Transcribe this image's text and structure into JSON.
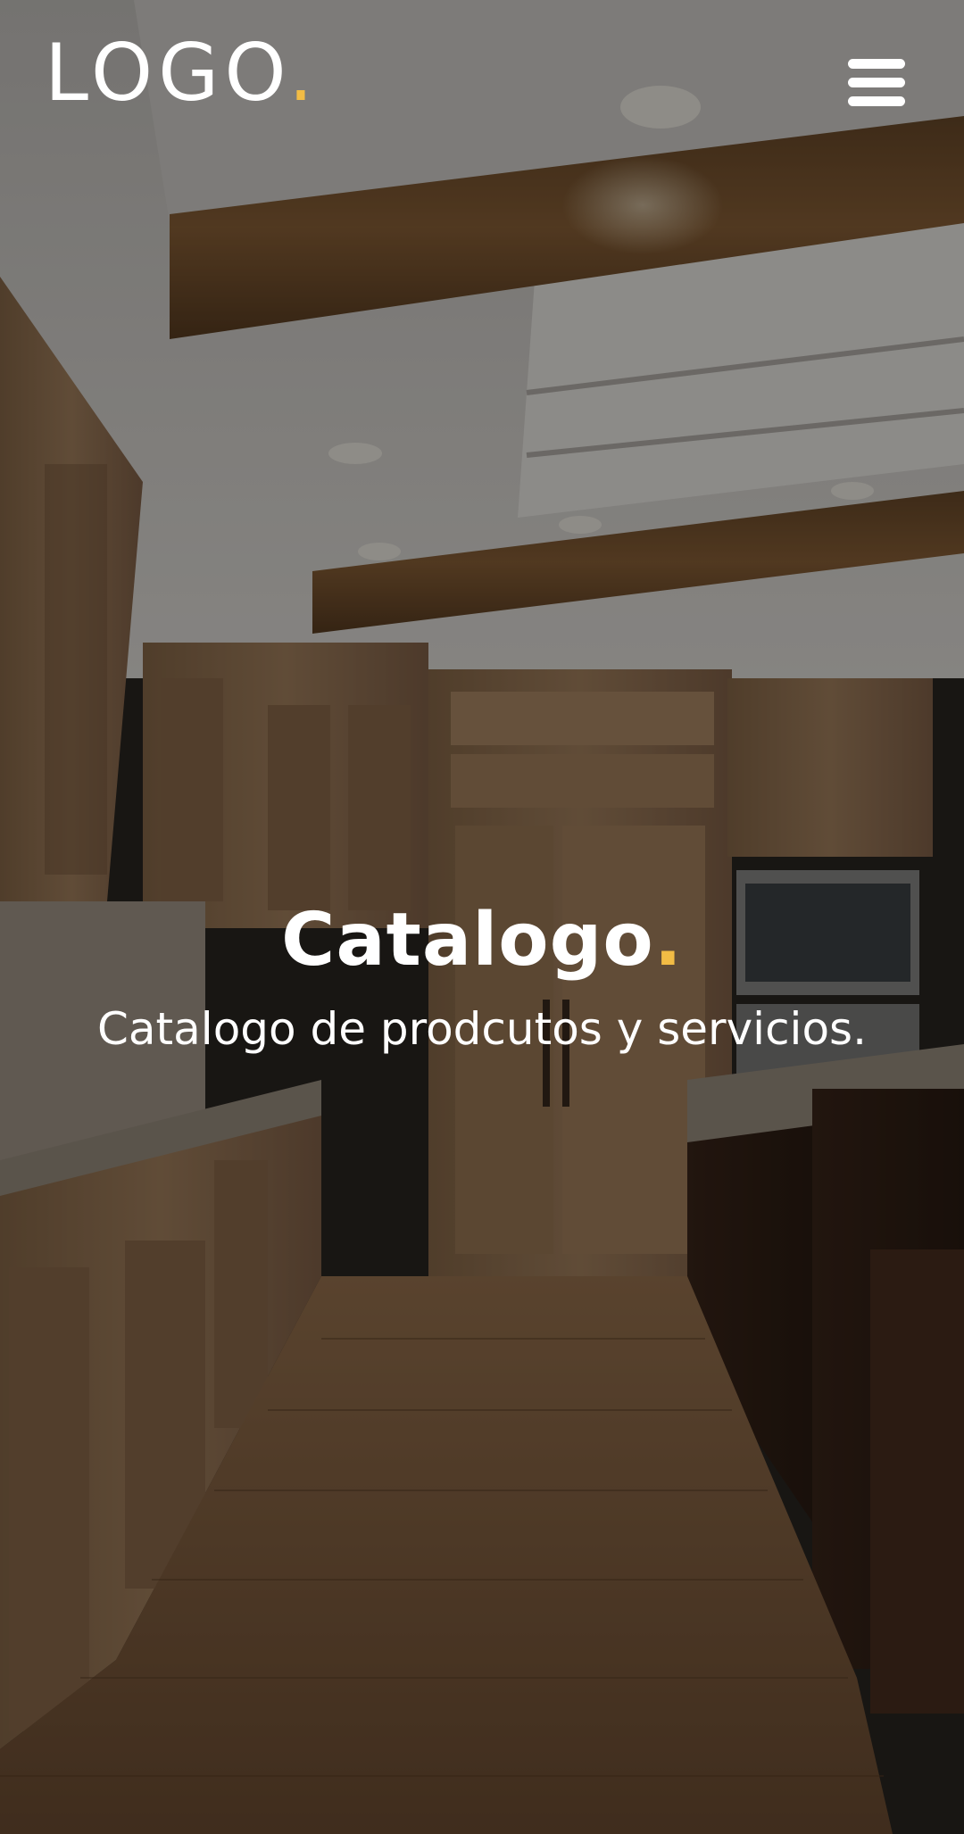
{
  "header": {
    "logo_text": "LOGO",
    "logo_dot": ".",
    "menu_icon": "hamburger-menu-icon"
  },
  "hero": {
    "title": "Catalogo",
    "title_dot": ".",
    "subtitle": "Catalogo de prodcutos y servicios."
  },
  "colors": {
    "accent": "#f2bc45",
    "text": "#ffffff",
    "overlay": "#000000"
  }
}
